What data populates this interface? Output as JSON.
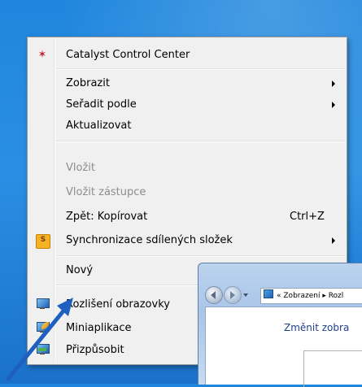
{
  "context_menu": {
    "items": [
      {
        "label": "Catalyst Control Center",
        "icon": "catalyst-icon"
      },
      {
        "label": "Zobrazit",
        "submenu": true
      },
      {
        "label": "Seřadit podle",
        "submenu": true
      },
      {
        "label": "Aktualizovat"
      },
      {
        "label": "Vložit",
        "disabled": true
      },
      {
        "label": "Vložit zástupce",
        "disabled": true
      },
      {
        "label": "Zpět: Kopírovat",
        "shortcut": "Ctrl+Z"
      },
      {
        "label": "Synchronizace sdílených složek",
        "submenu": true,
        "icon": "sync-folder-icon",
        "icon_glyph": "S"
      },
      {
        "label": "Nový",
        "submenu": true
      },
      {
        "label": "Rozlišení obrazovky",
        "icon": "screen-resolution-icon"
      },
      {
        "label": "Miniaplikace",
        "icon": "gadgets-icon"
      },
      {
        "label": "Přizpůsobit",
        "icon": "personalize-icon"
      }
    ]
  },
  "window": {
    "address_prefix": "«",
    "address_text": "Zobrazení ▸ Rozl",
    "heading": "Změnit zobra"
  },
  "colors": {
    "desktop": "#2a8fe4",
    "menu_background": "#f0f0f0",
    "disabled_text": "#8d8d8d",
    "arrow_pointer": "#1f5fbf"
  }
}
